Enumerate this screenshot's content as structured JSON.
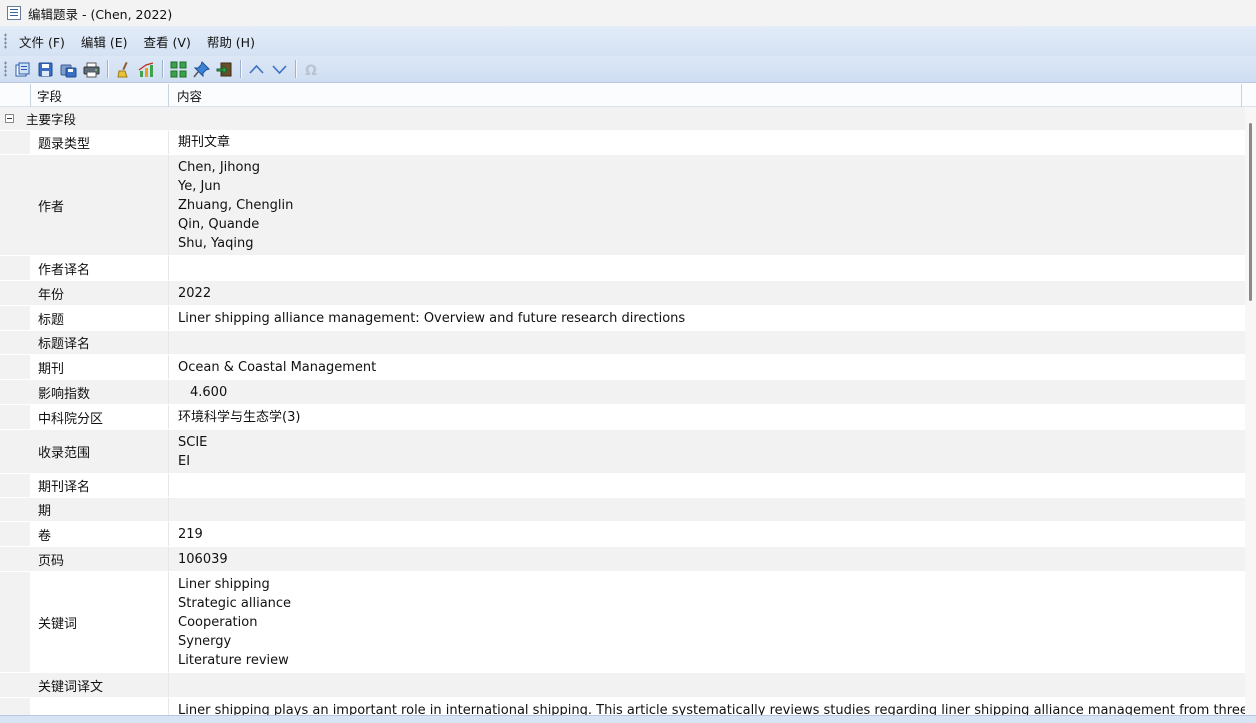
{
  "window": {
    "title": "编辑题录 - (Chen, 2022)"
  },
  "menu": {
    "file": "文件 (F)",
    "edit": "编辑 (E)",
    "view": "查看 (V)",
    "help": "帮助 (H)"
  },
  "toolbar_icons": [
    "new-record-icon",
    "save-icon",
    "save-copy-icon",
    "print-icon",
    "clean-brush-icon",
    "chart-icon",
    "grid-icon",
    "pin-icon",
    "export-icon",
    "move-up-icon",
    "move-down-icon",
    "omega-icon"
  ],
  "columns": {
    "field": "字段",
    "content": "内容"
  },
  "group": {
    "label": "主要字段"
  },
  "fields": {
    "type": {
      "label": "题录类型",
      "value": "期刊文章"
    },
    "authors": {
      "label": "作者",
      "values": [
        "Chen, Jihong",
        "Ye, Jun",
        "Zhuang, Chenglin",
        "Qin, Quande",
        "Shu, Yaqing"
      ]
    },
    "author_trans": {
      "label": "作者译名",
      "value": ""
    },
    "year": {
      "label": "年份",
      "value": "2022"
    },
    "title": {
      "label": "标题",
      "value": "Liner shipping alliance management: Overview and future research directions"
    },
    "title_trans": {
      "label": "标题译名",
      "value": ""
    },
    "journal": {
      "label": "期刊",
      "value": "Ocean & Coastal Management"
    },
    "impact": {
      "label": "影响指数",
      "value": "4.600"
    },
    "cas": {
      "label": "中科院分区",
      "value": "环境科学与生态学(3)"
    },
    "indexing": {
      "label": "收录范围",
      "values": [
        "SCIE",
        "EI"
      ]
    },
    "journal_trans": {
      "label": "期刊译名",
      "value": ""
    },
    "issue": {
      "label": "期",
      "value": ""
    },
    "volume": {
      "label": "卷",
      "value": "219"
    },
    "pages": {
      "label": "页码",
      "value": "106039"
    },
    "keywords": {
      "label": "关键词",
      "values": [
        "Liner shipping",
        "Strategic alliance",
        "Cooperation",
        "Synergy",
        "Literature review"
      ]
    },
    "keywords_trans": {
      "label": "关键词译文",
      "value": ""
    },
    "abstract": {
      "label": "",
      "value": "Liner shipping plays an important role in international shipping. This article systematically reviews studies regarding liner shipping alliance management from three"
    }
  },
  "colors": {
    "menubar": "#d4e2f4",
    "alt_row": "#f2f2f2"
  }
}
